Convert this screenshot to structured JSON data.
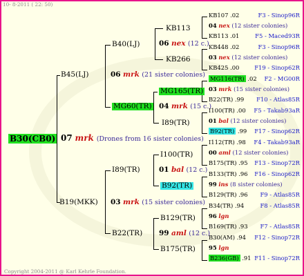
{
  "header": "10- 8-2011 ( 22: 50)",
  "footer": "Copyright 2004-2011 @ Karl Kehrle Foundation.",
  "root": {
    "label": "B30(CB0)",
    "year": "07",
    "mark": "mrk",
    "note": "(Drones from 16 sister colonies)"
  },
  "gen1": [
    {
      "label": "B45(LJ)",
      "year": "06",
      "mark": "mrk",
      "note": "(21 sister colonies)"
    },
    {
      "label": "B19(MKK)",
      "year": "03",
      "mark": "mrk",
      "note": "(15 sister colonies)"
    }
  ],
  "gen2": [
    {
      "label": "B40(LJ)",
      "year": "06",
      "mark": "nex",
      "note": "(12 c.)"
    },
    {
      "label": "MG60(TR)",
      "year": "04",
      "mark": "mrk",
      "note": "(15 c.)"
    },
    {
      "label": "I89(TR)",
      "year": "01",
      "mark": "bal",
      "note": "(12 c.)"
    },
    {
      "label": "B22(TR)",
      "year": "99",
      "mark": "aml",
      "note": "(12 c.)"
    }
  ],
  "gen3": [
    {
      "label": "KB113"
    },
    {
      "label": "KB266"
    },
    {
      "label": "MG165(TR)"
    },
    {
      "label": "I89(TR)"
    },
    {
      "label": "I100(TR)"
    },
    {
      "label": "B92(TR)"
    },
    {
      "label": "B129(TR)"
    },
    {
      "label": "B175(TR)"
    }
  ],
  "gen4": [
    {
      "top": {
        "name": "KB107",
        "yr": ".02",
        "site": "F3 - Sinop96R"
      },
      "mid": {
        "yr": "04",
        "mark": "nex",
        "note": "(12 sister colonies)"
      },
      "bot": {
        "name": "KB113",
        "yr": ".01",
        "site": "F5 - Maced93R"
      }
    },
    {
      "top": {
        "name": "KB448",
        "yr": ".02",
        "site": "F3 - Sinop96R"
      },
      "mid": {
        "yr": "03",
        "mark": "nex",
        "note": "(12 sister colonies)"
      },
      "bot": {
        "name": "KB425",
        "yr": ".00",
        "site": "F19 - Sinop62R"
      }
    },
    {
      "top": {
        "name": "MG116(TR)",
        "yr": ".02",
        "site": "F2 - MG00R"
      },
      "mid": {
        "yr": "03",
        "mark": "mrk",
        "note": "(15 sister colonies)"
      },
      "bot": {
        "name": "B22(TR)",
        "yr": ".99",
        "site": "F10 - Atlas85R"
      }
    },
    {
      "top": {
        "name": "I100(TR)",
        "yr": ".00",
        "site": "F5 - Takab93aR"
      },
      "mid": {
        "yr": "01",
        "mark": "bal",
        "note": "(12 sister colonies)"
      },
      "bot": {
        "name": "B92(TR)",
        "yr": ".99",
        "site": "F17 - Sinop62R"
      }
    },
    {
      "top": {
        "name": "I112(TR)",
        "yr": ".98",
        "site": "F4 - Takab93aR"
      },
      "mid": {
        "yr": "00",
        "mark": "aml",
        "note": "(12 sister colonies)"
      },
      "bot": {
        "name": "B175(TR)",
        "yr": ".95",
        "site": "F13 - Sinop72R"
      }
    },
    {
      "top": {
        "name": "B133(TR)",
        "yr": ".96",
        "site": "F16 - Sinop62R"
      },
      "mid": {
        "yr": "99",
        "mark": "ins",
        "note": "(8 sister colonies)"
      },
      "bot": {
        "name": "B129(TR)",
        "yr": ".96",
        "site": "F9 - Atlas85R"
      }
    },
    {
      "top": {
        "name": "B34(TR)",
        "yr": ".94",
        "site": "F8 - Atlas85R"
      },
      "mid": {
        "yr": "96",
        "mark": "lgn",
        "note": ""
      },
      "bot": {
        "name": "B169(TR)",
        "yr": ".93",
        "site": "F7 - Atlas85R"
      }
    },
    {
      "top": {
        "name": "B30(AM)",
        "yr": ".94",
        "site": "F12 - Sinop72R"
      },
      "mid": {
        "yr": "95",
        "mark": "lgn",
        "note": ""
      },
      "bot": {
        "name": "B236(GB)",
        "yr": ".91",
        "site": "F11 - Sinop72R"
      }
    }
  ]
}
